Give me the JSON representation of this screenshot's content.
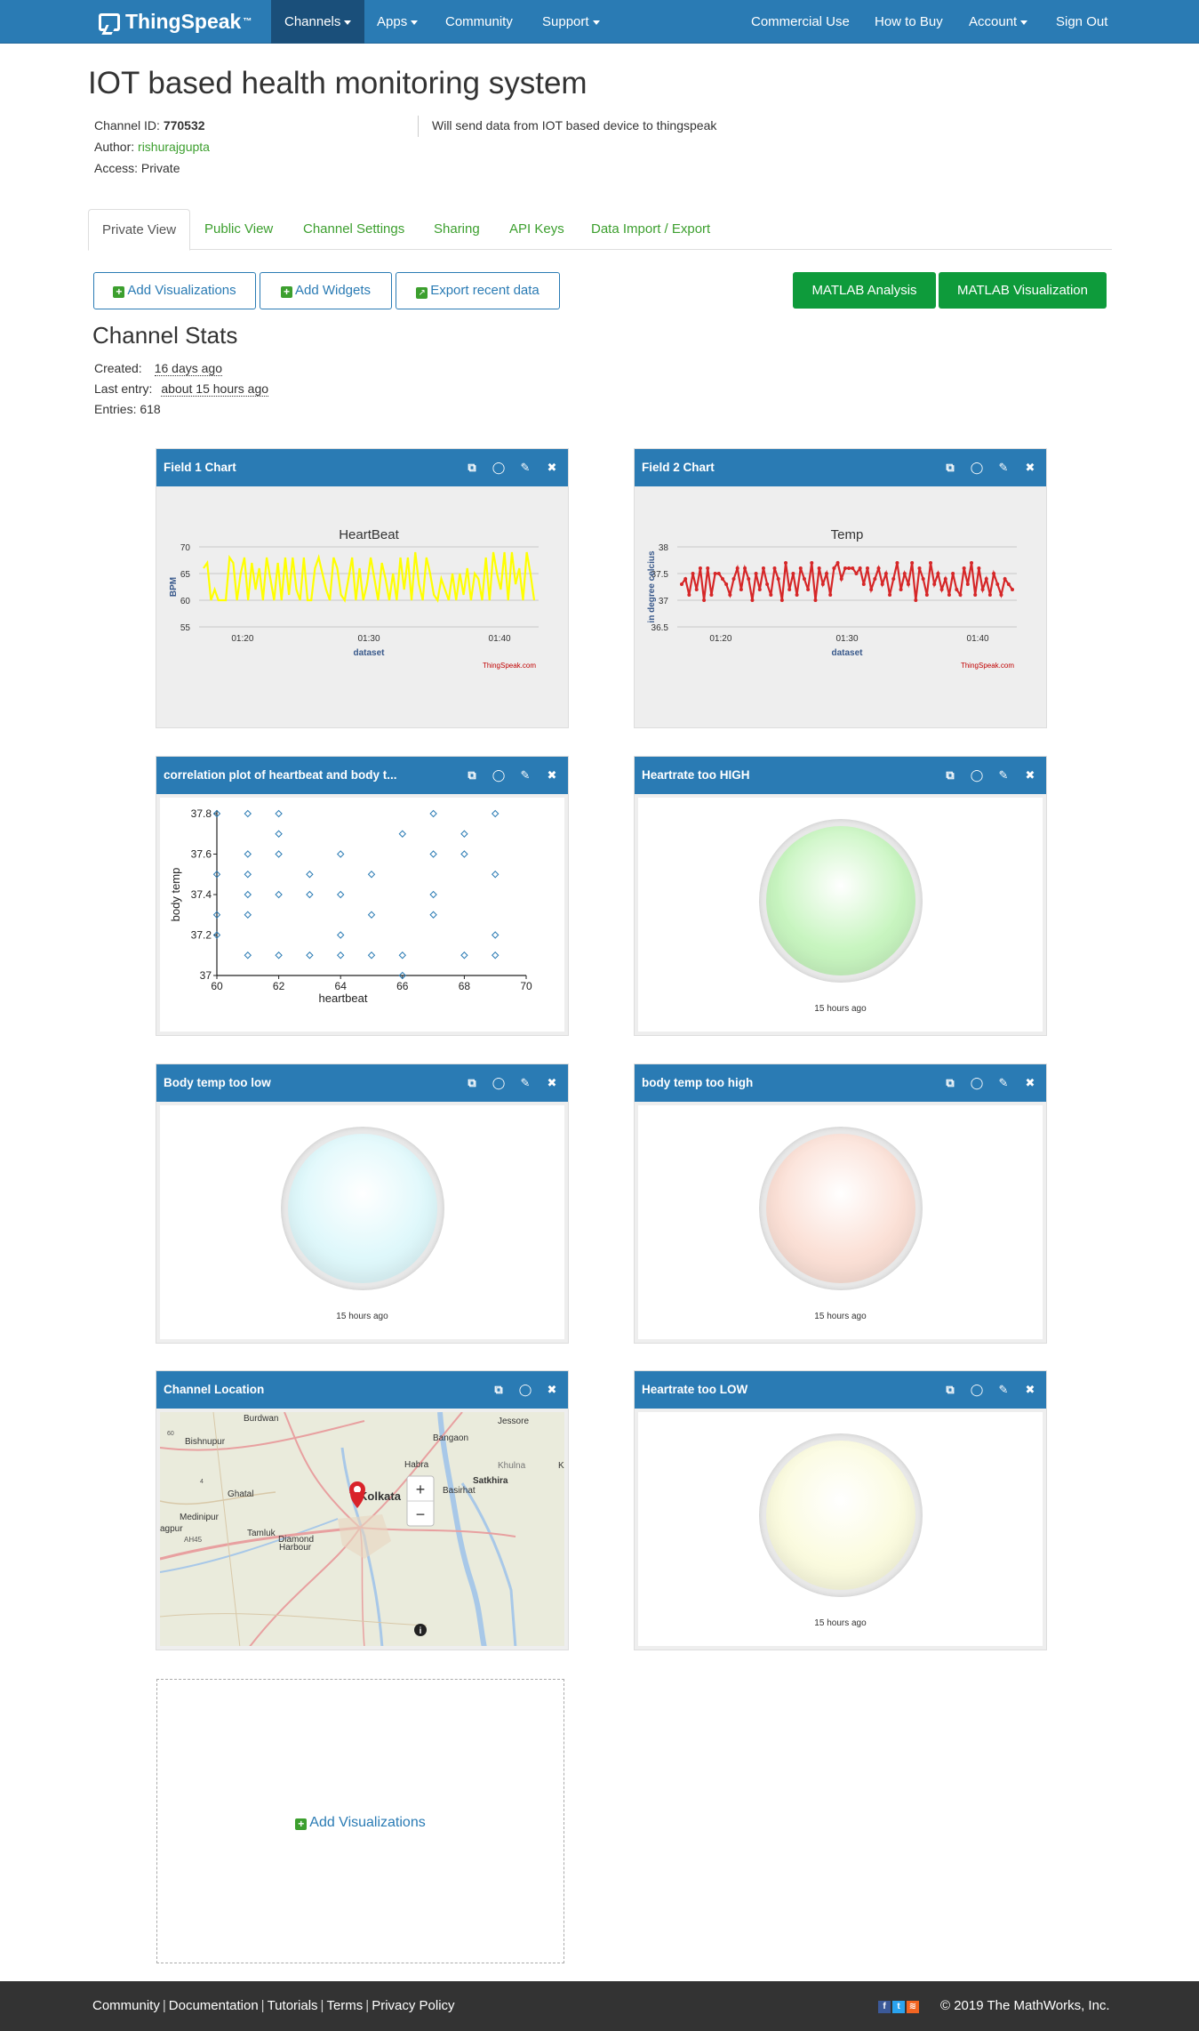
{
  "nav": {
    "brand": "ThingSpeak",
    "brand_tm": "™",
    "items": [
      {
        "label": "Channels",
        "dropdown": true,
        "active": true
      },
      {
        "label": "Apps",
        "dropdown": true
      },
      {
        "label": "Community"
      },
      {
        "label": "Support",
        "dropdown": true
      }
    ],
    "right_items": [
      {
        "label": "Commercial Use"
      },
      {
        "label": "How to Buy"
      },
      {
        "label": "Account",
        "dropdown": true
      },
      {
        "label": "Sign Out"
      }
    ]
  },
  "channel": {
    "title": "IOT based health monitoring system",
    "id_label": "Channel ID:",
    "id": "770532",
    "author_label": "Author:",
    "author": "rishurajgupta",
    "access_label": "Access:",
    "access": "Private",
    "description": "Will send data from IOT based device to thingspeak"
  },
  "tabs": [
    "Private View",
    "Public View",
    "Channel Settings",
    "Sharing",
    "API Keys",
    "Data Import / Export"
  ],
  "actions": {
    "add_visualizations": "Add Visualizations",
    "add_widgets": "Add Widgets",
    "export_recent": "Export recent data",
    "matlab_analysis": "MATLAB Analysis",
    "matlab_visualization": "MATLAB Visualization"
  },
  "stats": {
    "title": "Channel Stats",
    "created_label": "Created:",
    "created": "16 days ago",
    "last_entry_label": "Last entry:",
    "last_entry": "about 15 hours ago",
    "entries_label": "Entries:",
    "entries": "618"
  },
  "widgets": {
    "field1": {
      "title": "Field 1 Chart"
    },
    "field2": {
      "title": "Field 2 Chart"
    },
    "corr": {
      "title": "correlation plot of heartbeat and body t..."
    },
    "hr_high": {
      "title": "Heartrate too HIGH",
      "time": "15 hours ago",
      "color": "#c8f5c0"
    },
    "bt_low": {
      "title": "Body temp too low",
      "time": "15 hours ago",
      "color": "#dff8fb"
    },
    "bt_high": {
      "title": "body temp too high",
      "time": "15 hours ago",
      "color": "#fbe0d6"
    },
    "location": {
      "title": "Channel Location"
    },
    "hr_low": {
      "title": "Heartrate too LOW",
      "time": "15 hours ago",
      "color": "#fbfbdf"
    }
  },
  "chart_data": [
    {
      "type": "line",
      "title": "HeartBeat",
      "xlabel": "dataset",
      "ylabel": "BPM",
      "x_ticks": [
        "01:20",
        "01:30",
        "01:40"
      ],
      "ylim": [
        55,
        70
      ],
      "y_ticks": [
        55,
        60,
        65,
        70
      ],
      "color": "#ffff00",
      "credit": "ThingSpeak.com",
      "series": [
        {
          "values": [
            66,
            67,
            60,
            62,
            60,
            60,
            60,
            68,
            67,
            60,
            65,
            68,
            60,
            67,
            62,
            66,
            60,
            68,
            64,
            60,
            67,
            60,
            68,
            61,
            68,
            62,
            60,
            68,
            60,
            60,
            66,
            68,
            65,
            62,
            60,
            68,
            66,
            61,
            60,
            64,
            68,
            60,
            66,
            60,
            63,
            68,
            64,
            60,
            67,
            64,
            60,
            65,
            60,
            68,
            62,
            68,
            60,
            69,
            63,
            60,
            68,
            65,
            61,
            60,
            64,
            62,
            60,
            65,
            60,
            65,
            61,
            66,
            60,
            65,
            64,
            60,
            68,
            60,
            69,
            65,
            62,
            69,
            60,
            69,
            63,
            66,
            60,
            69,
            65,
            60
          ]
        }
      ]
    },
    {
      "type": "line",
      "title": "Temp",
      "xlabel": "dataset",
      "ylabel": "in degree celcius",
      "x_ticks": [
        "01:20",
        "01:30",
        "01:40"
      ],
      "ylim": [
        36.5,
        38
      ],
      "y_ticks": [
        36.5,
        37,
        37.5,
        38
      ],
      "color": "#d62728",
      "credit": "ThingSpeak.com",
      "series": [
        {
          "values": [
            37.3,
            37.4,
            37.1,
            37.5,
            37.2,
            37.6,
            37.0,
            37.6,
            37.1,
            37.5,
            37.5,
            37.4,
            37.3,
            37.1,
            37.4,
            37.6,
            37.2,
            37.6,
            37.4,
            37.0,
            37.5,
            37.2,
            37.6,
            37.3,
            37.1,
            37.6,
            37.4,
            37.0,
            37.7,
            37.2,
            37.5,
            37.1,
            37.6,
            37.4,
            37.2,
            37.7,
            37.0,
            37.6,
            37.3,
            37.5,
            37.1,
            37.6,
            37.7,
            37.4,
            37.6,
            37.6,
            37.6,
            37.5,
            37.6,
            37.3,
            37.6,
            37.2,
            37.4,
            37.6,
            37.3,
            37.5,
            37.1,
            37.4,
            37.7,
            37.2,
            37.5,
            37.3,
            37.7,
            37.0,
            37.6,
            37.4,
            37.1,
            37.7,
            37.3,
            37.5,
            37.2,
            37.4,
            37.1,
            37.5,
            37.2,
            37.1,
            37.6,
            37.3,
            37.7,
            37.1,
            37.6,
            37.2,
            37.4,
            37.1,
            37.5,
            37.3,
            37.1,
            37.4,
            37.3,
            37.2
          ]
        }
      ]
    },
    {
      "type": "scatter",
      "xlabel": "heartbeat",
      "ylabel": "body temp",
      "xlim": [
        60,
        70
      ],
      "ylim": [
        37,
        37.8
      ],
      "x_ticks": [
        60,
        62,
        64,
        66,
        68,
        70
      ],
      "y_ticks": [
        37,
        37.2,
        37.4,
        37.6,
        37.8
      ],
      "color": "#2a7bb4",
      "points": [
        [
          60,
          37.8
        ],
        [
          60,
          37.5
        ],
        [
          60,
          37.3
        ],
        [
          60,
          37.2
        ],
        [
          61,
          37.8
        ],
        [
          61,
          37.6
        ],
        [
          61,
          37.5
        ],
        [
          61,
          37.4
        ],
        [
          61,
          37.3
        ],
        [
          61,
          37.1
        ],
        [
          62,
          37.8
        ],
        [
          62,
          37.7
        ],
        [
          62,
          37.6
        ],
        [
          62,
          37.4
        ],
        [
          62,
          37.1
        ],
        [
          63,
          37.5
        ],
        [
          63,
          37.4
        ],
        [
          63,
          37.1
        ],
        [
          64,
          37.6
        ],
        [
          64,
          37.4
        ],
        [
          64,
          37.2
        ],
        [
          64,
          37.1
        ],
        [
          65,
          37.5
        ],
        [
          65,
          37.3
        ],
        [
          65,
          37.1
        ],
        [
          66,
          37.7
        ],
        [
          66,
          37.1
        ],
        [
          66,
          37.0
        ],
        [
          67,
          37.8
        ],
        [
          67,
          37.6
        ],
        [
          67,
          37.4
        ],
        [
          67,
          37.3
        ],
        [
          68,
          37.7
        ],
        [
          68,
          37.6
        ],
        [
          68,
          37.1
        ],
        [
          69,
          37.8
        ],
        [
          69,
          37.5
        ],
        [
          69,
          37.2
        ],
        [
          69,
          37.1
        ]
      ]
    }
  ],
  "map": {
    "labels": [
      "Burdwan",
      "Jessore",
      "Bishnupur",
      "Bangaon",
      "Khulna",
      "Habra",
      "Satkhira",
      "Basirhat",
      "Ghatal",
      "Kolkata",
      "Medinipur",
      "Tamluk",
      "Diamond",
      "Harbour",
      "agpur",
      "AH45",
      "60",
      "4",
      "Kl"
    ],
    "zoom_in": "+",
    "zoom_out": "−",
    "info": "i"
  },
  "add_vis_placeholder": "Add Visualizations",
  "footer": {
    "links": [
      "Community",
      "Documentation",
      "Tutorials",
      "Terms",
      "Privacy Policy"
    ],
    "copyright": "© 2019 The MathWorks, Inc.",
    "social": [
      "f",
      "t",
      "rss"
    ]
  }
}
